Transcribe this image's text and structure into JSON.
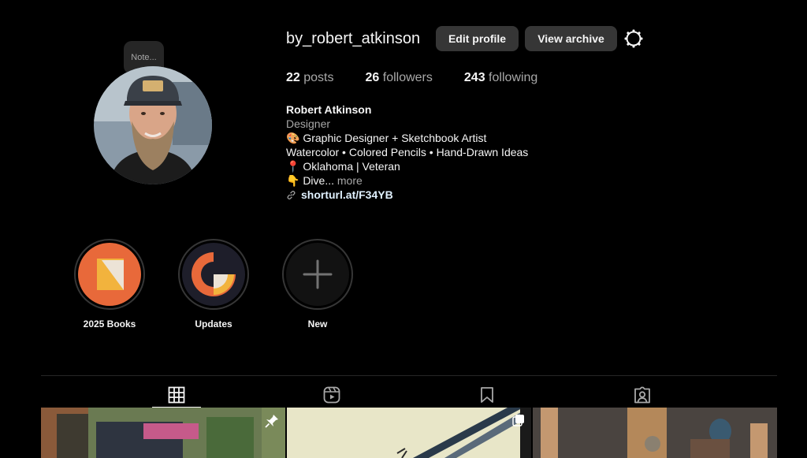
{
  "profile": {
    "note": "Note...",
    "username": "by_robert_atkinson",
    "edit_label": "Edit profile",
    "archive_label": "View archive",
    "stats": {
      "posts_count": "22",
      "posts_label": "posts",
      "followers_count": "26",
      "followers_label": "followers",
      "following_count": "243",
      "following_label": "following"
    },
    "bio": {
      "name": "Robert Atkinson",
      "category": "Designer",
      "line1": "🎨 Graphic Designer + Sketchbook Artist",
      "line2": "Watercolor • Colored Pencils • Hand-Drawn Ideas",
      "line3": "📍 Oklahoma | Veteran",
      "line4": "👇 Dive...",
      "more": "more",
      "link": "shorturl.at/F34YB"
    }
  },
  "highlights": [
    {
      "label": "2025 Books"
    },
    {
      "label": "Updates"
    },
    {
      "label": "New"
    }
  ],
  "tabs": [
    "grid-icon",
    "reels-icon",
    "saved-icon",
    "tagged-icon"
  ],
  "colors": {
    "background": "#000000",
    "button": "#363636",
    "accent_orange": "#e8693a",
    "accent_yellow": "#f2b33d"
  }
}
